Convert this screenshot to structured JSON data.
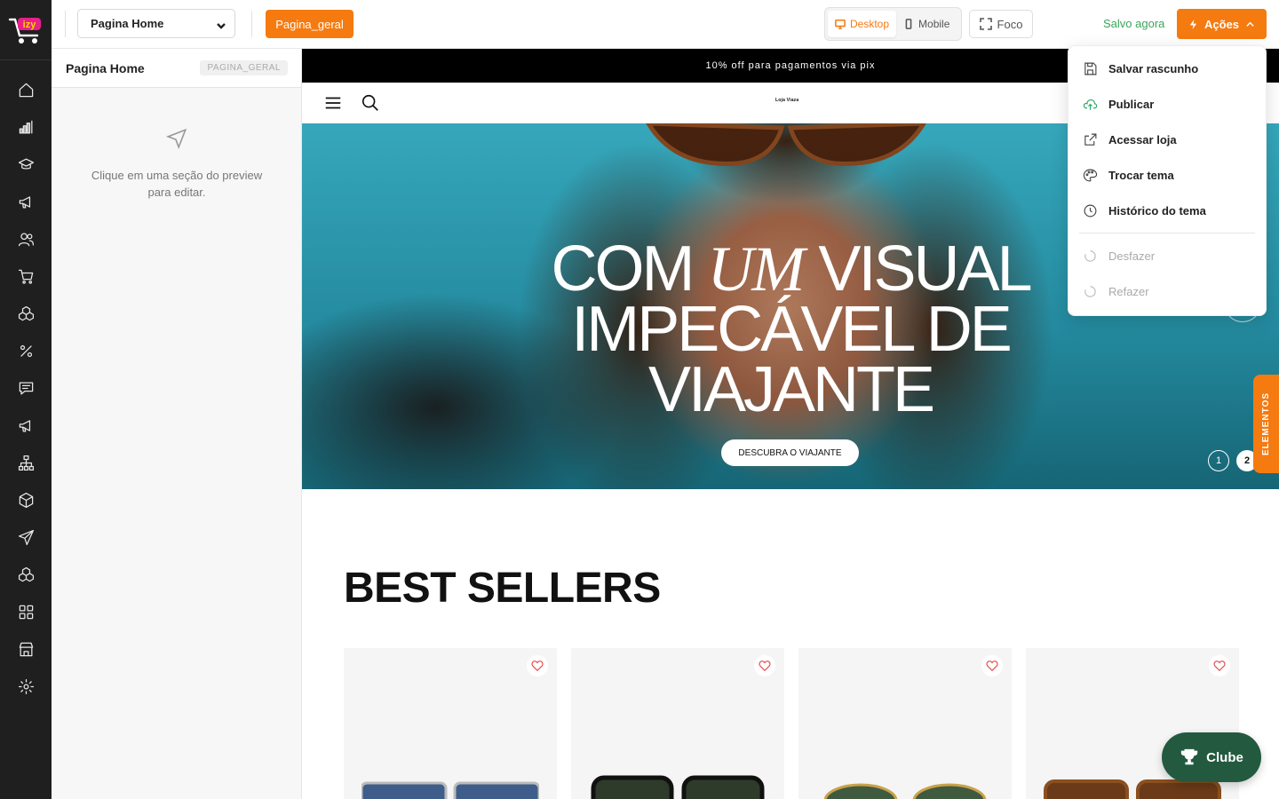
{
  "app": {
    "logo_text": "izy"
  },
  "topbar": {
    "page_select": "Pagina Home",
    "tag_button": "Pagina_geral",
    "view_modes": [
      {
        "label": "Desktop",
        "active": true
      },
      {
        "label": "Mobile",
        "active": false
      }
    ],
    "focus_label": "Foco",
    "saved_status": "Salvo agora",
    "actions_label": "Ações"
  },
  "side_panel": {
    "title": "Pagina Home",
    "tag": "PAGINA_GERAL",
    "hint": "Clique em uma seção do preview para editar."
  },
  "preview": {
    "promo_text": "10% off para pagamentos via pix",
    "store_logo": "Loja Viaza",
    "hero": {
      "title_part1": "COM ",
      "title_em": "UM",
      "title_part2": " VISUAL IMPECÁVEL DE VIAJANTE",
      "cta": "DESCUBRA O VIAJANTE",
      "slides": [
        "1",
        "2"
      ],
      "active_slide": 2
    },
    "section_title": "BEST SELLERS",
    "product_count_visible": 4
  },
  "floating": {
    "elements_tab": "ELEMENTOS",
    "club_button": "Clube"
  },
  "actions_menu": {
    "items": [
      {
        "label": "Salvar rascunho",
        "icon": "save-icon"
      },
      {
        "label": "Publicar",
        "icon": "cloud-upload-icon"
      },
      {
        "label": "Acessar loja",
        "icon": "external-link-icon"
      },
      {
        "label": "Trocar tema",
        "icon": "palette-icon"
      },
      {
        "label": "Histórico do tema",
        "icon": "clock-icon"
      }
    ],
    "disabled_items": [
      {
        "label": "Desfazer",
        "icon": "undo-icon"
      },
      {
        "label": "Refazer",
        "icon": "redo-icon"
      }
    ]
  },
  "colors": {
    "accent": "#f57a10",
    "rail": "#1f1f1f",
    "saved": "#3aa65a",
    "club": "#235a3f"
  }
}
